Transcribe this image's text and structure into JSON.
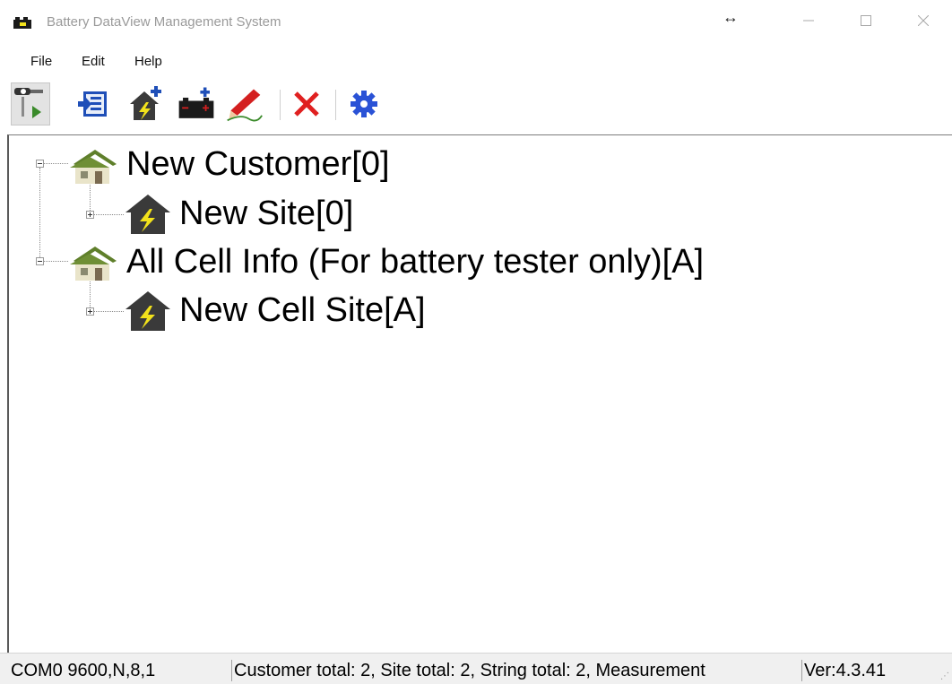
{
  "window": {
    "title": "Battery DataView Management System",
    "app_icon": "battery-tester-icon"
  },
  "menu": {
    "items": [
      {
        "label": "File"
      },
      {
        "label": "Edit"
      },
      {
        "label": "Help"
      }
    ]
  },
  "toolbar": {
    "buttons": [
      {
        "icon": "connect-tester-icon",
        "state": "active"
      },
      {
        "icon": "import-data-icon"
      },
      {
        "icon": "add-site-icon"
      },
      {
        "icon": "add-battery-icon"
      },
      {
        "icon": "edit-pen-icon"
      },
      {
        "icon": "delete-x-icon"
      },
      {
        "icon": "settings-gear-icon"
      }
    ]
  },
  "tree": {
    "customers": [
      {
        "label": "New Customer[0]",
        "expanded": true,
        "sites": [
          {
            "label": "New Site[0]",
            "expanded": false
          }
        ]
      },
      {
        "label": "All Cell Info (For battery tester only)[A]",
        "expanded": true,
        "sites": [
          {
            "label": "New Cell Site[A]",
            "expanded": false
          }
        ]
      }
    ]
  },
  "statusbar": {
    "port": "COM0 9600,N,8,1",
    "summary": "Customer total: 2,  Site total: 2,  String total: 2,  Measurement",
    "version": "Ver:4.3.41"
  },
  "colors": {
    "house_roof": "#5f7f2b",
    "house_wall": "#e9e4c9",
    "site_house": "#3a3a3a",
    "lightning": "#f2e21b",
    "delete_red": "#e02020",
    "settings_blue": "#2a52d6",
    "pen_red": "#d42020"
  }
}
